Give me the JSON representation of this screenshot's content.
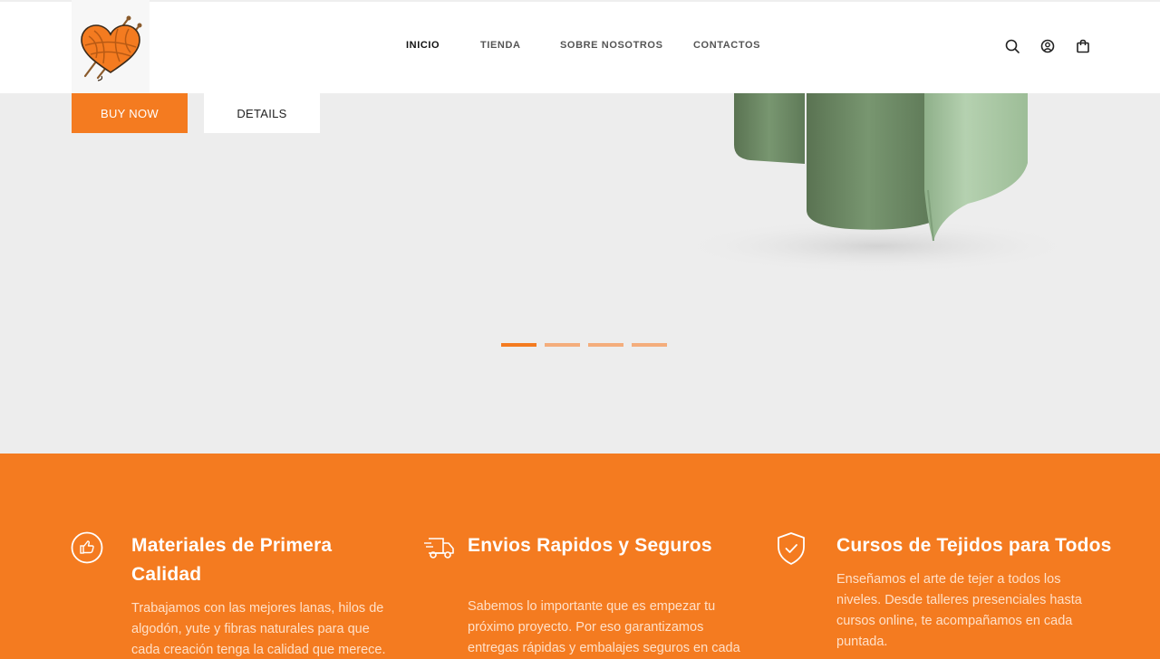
{
  "header": {
    "logo_icon": "yarn-heart-logo-icon",
    "nav": [
      {
        "label": "INICIO",
        "active": true
      },
      {
        "label": "TIENDA",
        "active": false
      },
      {
        "label": "SOBRE NOSOTROS",
        "active": false
      },
      {
        "label": "CONTACTOS",
        "active": false
      }
    ],
    "icons": [
      "search-icon",
      "account-icon",
      "cart-bag-icon"
    ]
  },
  "hero": {
    "buy_label": "BUY NOW",
    "details_label": "DETAILS",
    "slides_count": 4,
    "active_slide": 1
  },
  "features": [
    {
      "icon": "thumbs-up-icon",
      "title_line1": "Materiales de Primera",
      "title_line2": "Calidad",
      "text_lines": [
        "Trabajamos con las mejores lanas, hilos de",
        "algodón, yute y fibras naturales para que",
        "cada creación tenga la calidad que merece."
      ]
    },
    {
      "icon": "delivery-truck-icon",
      "title_line1": "Envios Rapidos y Seguros",
      "title_line2": "",
      "text_lines": [
        "Sabemos lo importante que es empezar tu",
        "próximo proyecto. Por eso garantizamos",
        "entregas rápidas y embalajes seguros en cada"
      ]
    },
    {
      "icon": "shield-check-icon",
      "title_line1": "Cursos de Tejidos para Todos",
      "title_line2": "",
      "text_lines": [
        "Enseñamos el arte de tejer a todos los",
        "niveles. Desde talleres presenciales hasta",
        "cursos online, te acompañamos en cada",
        "puntada."
      ]
    }
  ],
  "colors": {
    "accent": "#f47b20",
    "accent_light": "#f4ad7c",
    "hero_bg": "#ededed",
    "product_green_dark": "#6f8c68",
    "product_green_light": "#a9c7a4"
  }
}
